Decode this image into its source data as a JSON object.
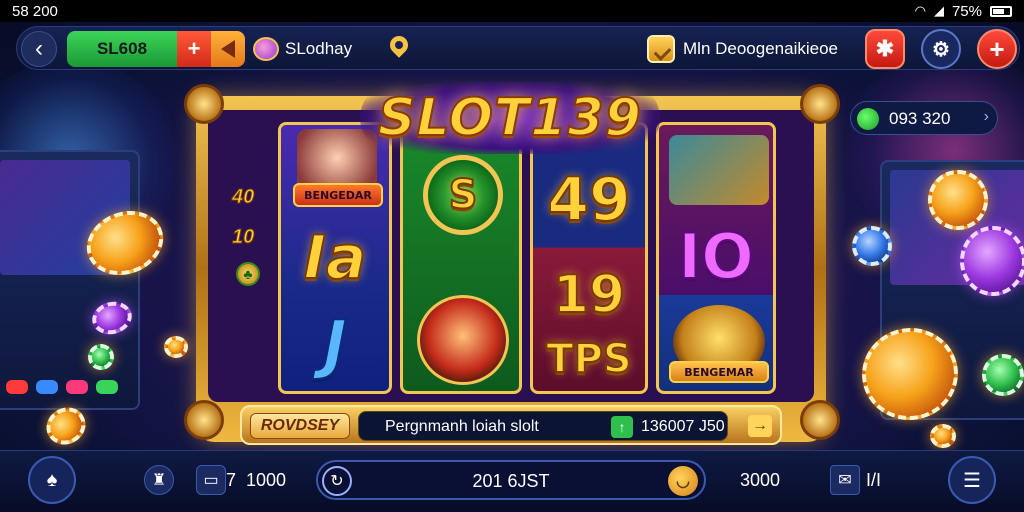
{
  "status_bar": {
    "time": "58 200",
    "battery": "75%",
    "icons": [
      "wifi-icon",
      "signal-icon",
      "battery-icon"
    ]
  },
  "top_bar": {
    "back_icon": "arrow-left-icon",
    "balance_label": "SL608",
    "add_label": "+",
    "tag_icon": "tag-icon",
    "username": "SLodhay",
    "location_icon": "location-pin-icon",
    "promo_text": "Mln Deoogenaikieoe",
    "red_action_icon": "star-burst-icon",
    "settings_icon": "gear-icon",
    "plus_round_label": "+"
  },
  "logo": {
    "title": "SLOT139"
  },
  "side_paylines": [
    "40",
    "10"
  ],
  "reels": {
    "reel1": {
      "banner": "BENGEDAR",
      "sym2": "Ia",
      "sym3": "J"
    },
    "reel2": {
      "sym1": "S"
    },
    "reel3": {
      "sym1": "49",
      "sym2": "19",
      "sym3": "TPS"
    },
    "reel4": {
      "sym2": "IO",
      "banner": "BENGEMAR"
    }
  },
  "info_bar": {
    "tag": "ROVDSEY",
    "message": "Pergnmanh loiah slolt",
    "win_value": "136007 J50",
    "arrow": "→"
  },
  "balance_pill": {
    "value": "093 320",
    "arrow": "›"
  },
  "bottom_bar": {
    "left_icon": "spade-icon",
    "bell_icon": "bell-icon",
    "wallet_icon": "wallet-icon",
    "wallet_label": "7",
    "wallet_value": "1000",
    "spin_icon": "refresh-icon",
    "spin_value": "201 6JST",
    "coin_icon": "coin-icon",
    "bet_value": "3000",
    "mail_icon": "mail-icon",
    "mail_label": "I/I",
    "menu_icon": "menu-icon"
  },
  "colors": {
    "accent_gold": "#f3c552",
    "green": "#2fbf4c",
    "red": "#d22a18",
    "background": "#1c1550"
  }
}
